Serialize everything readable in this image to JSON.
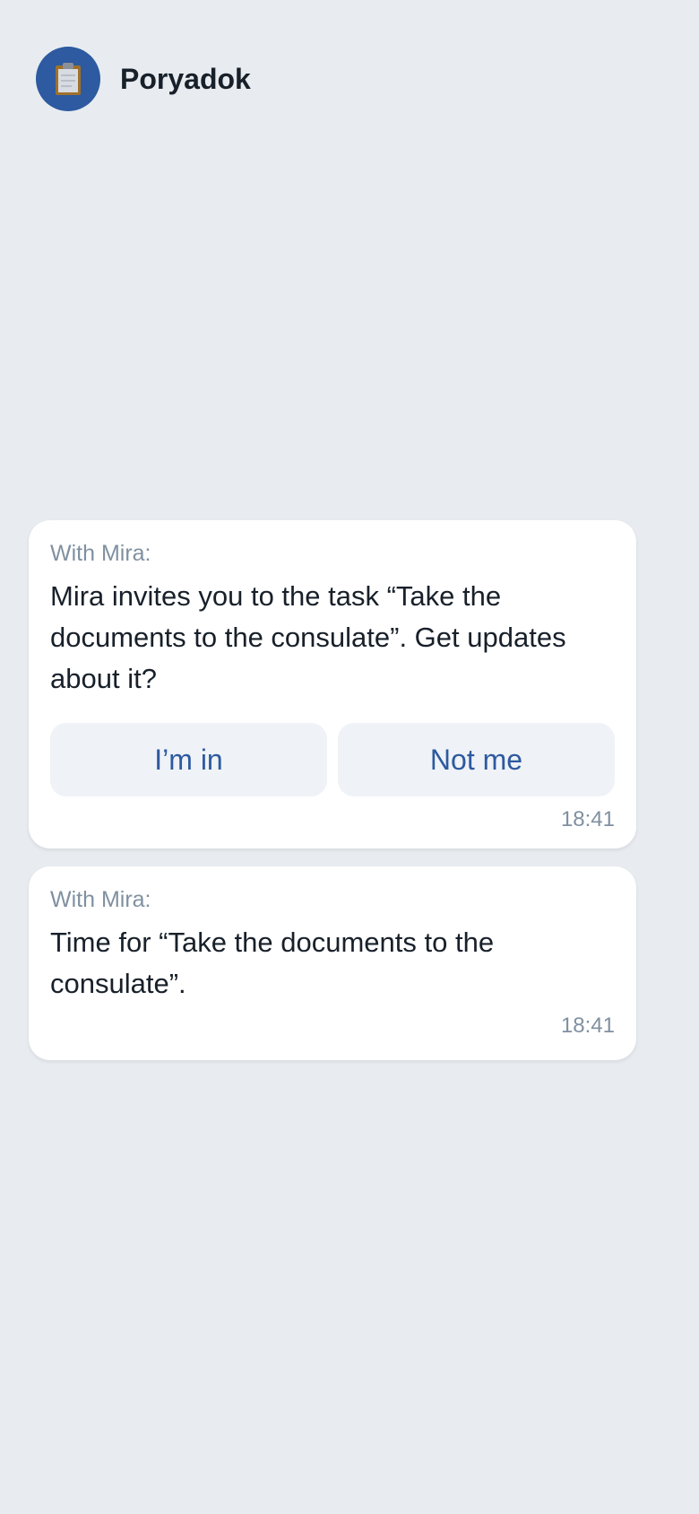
{
  "header": {
    "title": "Poryadok",
    "avatar_icon": "clipboard-icon",
    "avatar_color": "#2d5aa0"
  },
  "messages": [
    {
      "sender": "With Mira:",
      "text": "Mira invites you to the task “Take the documents to the consulate”. Get updates about it?",
      "buttons": [
        "I’m in",
        "Not me"
      ],
      "time": "18:41"
    },
    {
      "sender": "With Mira:",
      "text": "Time for “Take the documents to the consulate”.",
      "time": "18:41"
    }
  ],
  "colors": {
    "background": "#e8ecf0",
    "accent": "#2d5aa0",
    "button_bg": "#eff2f6",
    "muted_text": "#8090a0"
  }
}
